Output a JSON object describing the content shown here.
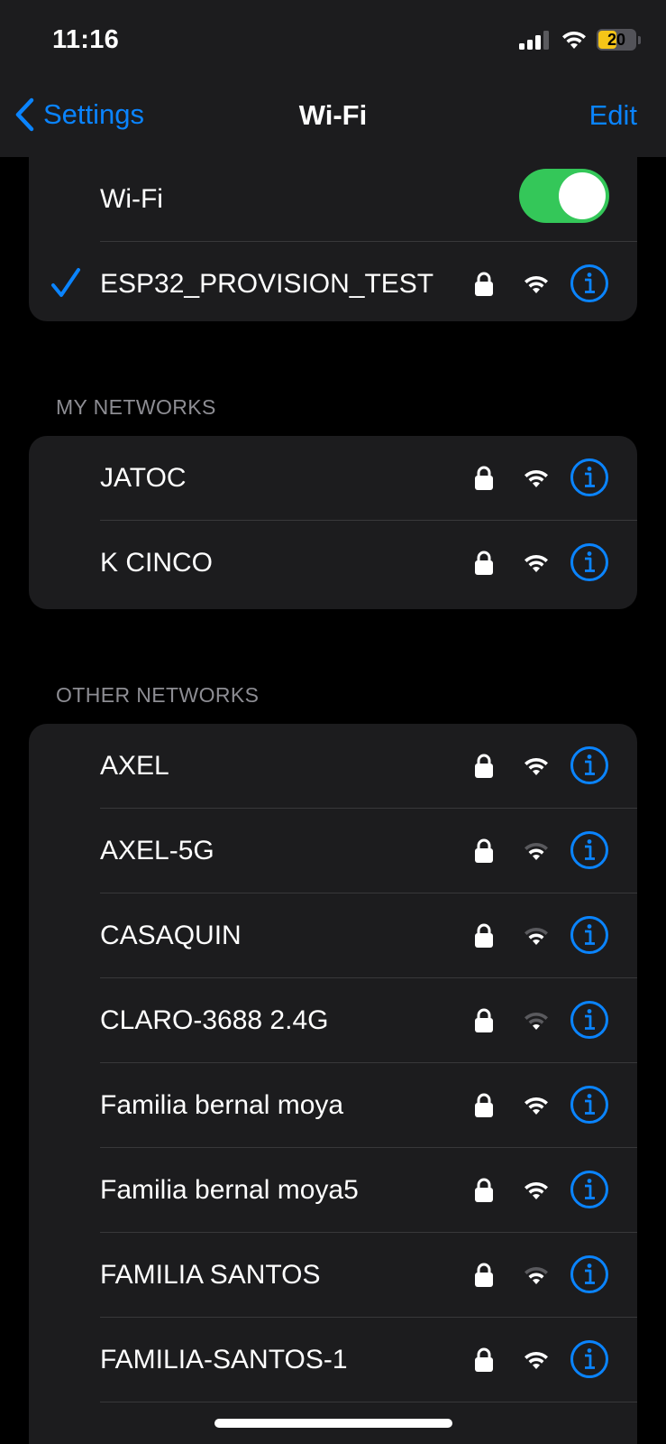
{
  "status_bar": {
    "time": "11:16",
    "battery_level": "20"
  },
  "nav": {
    "back_label": "Settings",
    "title": "Wi-Fi",
    "edit_label": "Edit"
  },
  "wifi_toggle": {
    "label": "Wi-Fi",
    "on": true
  },
  "connected": {
    "name": "ESP32_PROVISION_TEST"
  },
  "my_networks": {
    "header": "MY NETWORKS",
    "items": [
      {
        "name": "JATOC",
        "signal": "full"
      },
      {
        "name": "K CINCO",
        "signal": "full"
      }
    ]
  },
  "other_networks": {
    "header": "OTHER NETWORKS",
    "items": [
      {
        "name": "AXEL",
        "signal": "full"
      },
      {
        "name": "AXEL-5G",
        "signal": "weak"
      },
      {
        "name": "CASAQUIN",
        "signal": "weak"
      },
      {
        "name": "CLARO-3688 2.4G",
        "signal": "weak"
      },
      {
        "name": "Familia bernal moya",
        "signal": "full"
      },
      {
        "name": "Familia bernal moya5",
        "signal": "full"
      },
      {
        "name": "FAMILIA SANTOS",
        "signal": "weak"
      },
      {
        "name": "FAMILIA-SANTOS-1",
        "signal": "full"
      }
    ]
  },
  "colors": {
    "accent": "#0a84ff",
    "toggle_on": "#34c759",
    "card_bg": "#1c1c1e",
    "battery": "#f5c518"
  }
}
